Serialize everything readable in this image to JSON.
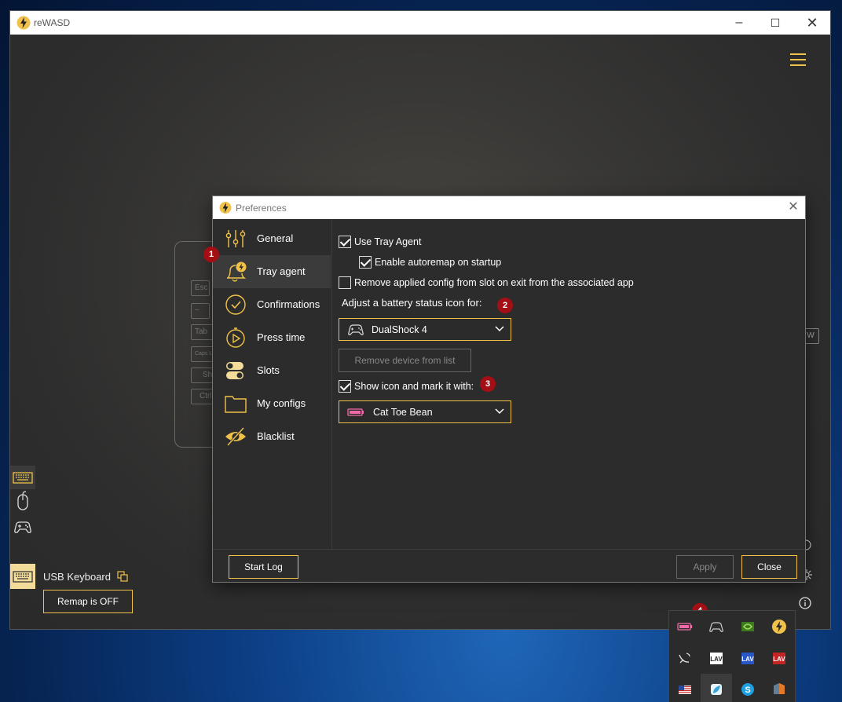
{
  "app": {
    "title": "reWASD",
    "device_name": "USB Keyboard",
    "remap_status": "Remap is OFF",
    "keyboard_keys": [
      "Esc",
      "~",
      "Tab",
      "Caps L",
      "Sh",
      "Ctrl"
    ],
    "right_edge_key": "W"
  },
  "dialog": {
    "title": "Preferences",
    "nav": [
      {
        "label": "General",
        "icon": "sliders-icon"
      },
      {
        "label": "Tray agent",
        "icon": "bell-bolt-icon"
      },
      {
        "label": "Confirmations",
        "icon": "check-circle-icon"
      },
      {
        "label": "Press time",
        "icon": "stopwatch-icon"
      },
      {
        "label": "Slots",
        "icon": "toggles-icon"
      },
      {
        "label": "My configs",
        "icon": "folder-icon"
      },
      {
        "label": "Blacklist",
        "icon": "eye-slash-icon"
      }
    ],
    "active_nav": "Tray agent",
    "options": {
      "use_tray_agent": {
        "label": "Use Tray Agent",
        "checked": true
      },
      "enable_autoremap": {
        "label": "Enable autoremap on startup",
        "checked": true
      },
      "remove_applied_config": {
        "label": "Remove applied config from slot on exit from the associated app",
        "checked": false
      },
      "battery_heading": "Adjust a battery status icon for:",
      "battery_device": "DualShock 4",
      "remove_device_label": "Remove device from list",
      "show_icon": {
        "label": "Show icon and mark it with:",
        "checked": true
      },
      "mark_style": "Cat Toe Bean"
    },
    "footer": {
      "start_log": "Start Log",
      "apply": "Apply",
      "close": "Close"
    }
  },
  "badges": [
    "1",
    "2",
    "3",
    "4"
  ],
  "colors": {
    "accent": "#f0c24a",
    "badge": "#a30f14",
    "battery_pink": "#f06aa8"
  }
}
